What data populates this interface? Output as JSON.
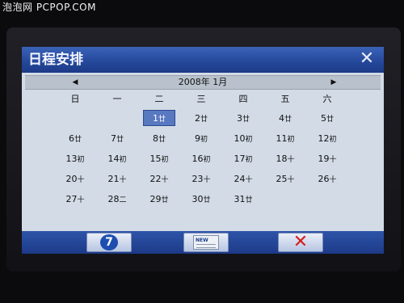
{
  "watermark": "泡泡网 PCPOP.COM",
  "window": {
    "title": "日程安排",
    "close_icon": "close-x-icon"
  },
  "month_nav": {
    "prev_icon": "triangle-left-icon",
    "label": "2008年 1月",
    "next_icon": "triangle-right-icon"
  },
  "weekdays": [
    "日",
    "一",
    "二",
    "三",
    "四",
    "五",
    "六"
  ],
  "calendar": {
    "selected_day": 1,
    "days": [
      {
        "day": "1",
        "lunar": "廿"
      },
      {
        "day": "2",
        "lunar": "廿"
      },
      {
        "day": "3",
        "lunar": "廿"
      },
      {
        "day": "4",
        "lunar": "廿"
      },
      {
        "day": "5",
        "lunar": "廿"
      },
      {
        "day": "6",
        "lunar": "廿"
      },
      {
        "day": "7",
        "lunar": "廿"
      },
      {
        "day": "8",
        "lunar": "廿"
      },
      {
        "day": "9",
        "lunar": "初"
      },
      {
        "day": "10",
        "lunar": "初"
      },
      {
        "day": "11",
        "lunar": "初"
      },
      {
        "day": "12",
        "lunar": "初"
      },
      {
        "day": "13",
        "lunar": "初"
      },
      {
        "day": "14",
        "lunar": "初"
      },
      {
        "day": "15",
        "lunar": "初"
      },
      {
        "day": "16",
        "lunar": "初"
      },
      {
        "day": "17",
        "lunar": "初"
      },
      {
        "day": "18",
        "lunar": "十"
      },
      {
        "day": "19",
        "lunar": "十"
      },
      {
        "day": "20",
        "lunar": "十"
      },
      {
        "day": "21",
        "lunar": "十"
      },
      {
        "day": "22",
        "lunar": "十"
      },
      {
        "day": "23",
        "lunar": "十"
      },
      {
        "day": "24",
        "lunar": "十"
      },
      {
        "day": "25",
        "lunar": "十"
      },
      {
        "day": "26",
        "lunar": "十"
      },
      {
        "day": "27",
        "lunar": "十"
      },
      {
        "day": "28",
        "lunar": "二"
      },
      {
        "day": "29",
        "lunar": "廿"
      },
      {
        "day": "30",
        "lunar": "廿"
      },
      {
        "day": "31",
        "lunar": "廿"
      }
    ]
  },
  "toolbar": {
    "today_button_icon": "today-seven-icon",
    "today_glyph": "7",
    "new_button_icon": "new-entry-icon",
    "new_tag": "NEW",
    "cancel_button_icon": "red-x-icon",
    "cancel_glyph": "✕"
  },
  "colors": {
    "screen_bg": "#d2dbe6",
    "titlebar": "#2b4fa3",
    "selected_day": "#5878c0",
    "cancel_x": "#d61d1d"
  }
}
